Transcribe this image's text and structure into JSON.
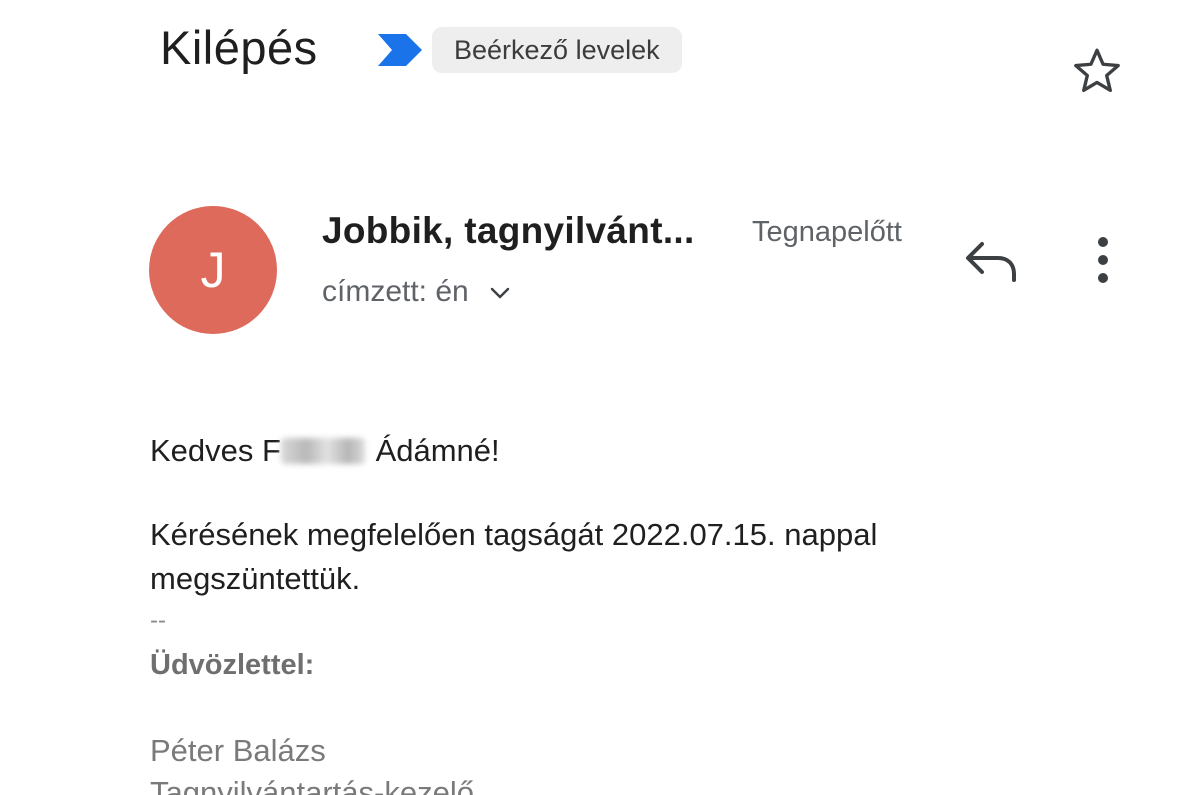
{
  "email": {
    "subject": "Kilépés",
    "label": "Beérkező levelek",
    "important_marker_icon": "important-marker-icon",
    "important_marker_color": "#1a73e8",
    "star_icon": "star-outline-icon"
  },
  "sender": {
    "avatar_initial": "J",
    "avatar_color": "#de6a5c",
    "name": "Jobbik, tagnyilvánt...",
    "date": "Tegnapelőtt",
    "recipient": "címzett: én",
    "reply_icon": "reply-icon",
    "more_icon": "more-vertical-icon"
  },
  "body": {
    "greeting_prefix": "Kedves F",
    "greeting_suffix": "Ádámné!",
    "message_line1": "Kérésének megfelelően tagságát 2022.07.15. nappal",
    "message_line2": "megszüntettük.",
    "signature_dash": "--",
    "signature_greeting": "Üdvözlettel:",
    "signature_name": "Péter Balázs",
    "signature_role": "Tagnyilvántartás-kezelő"
  }
}
